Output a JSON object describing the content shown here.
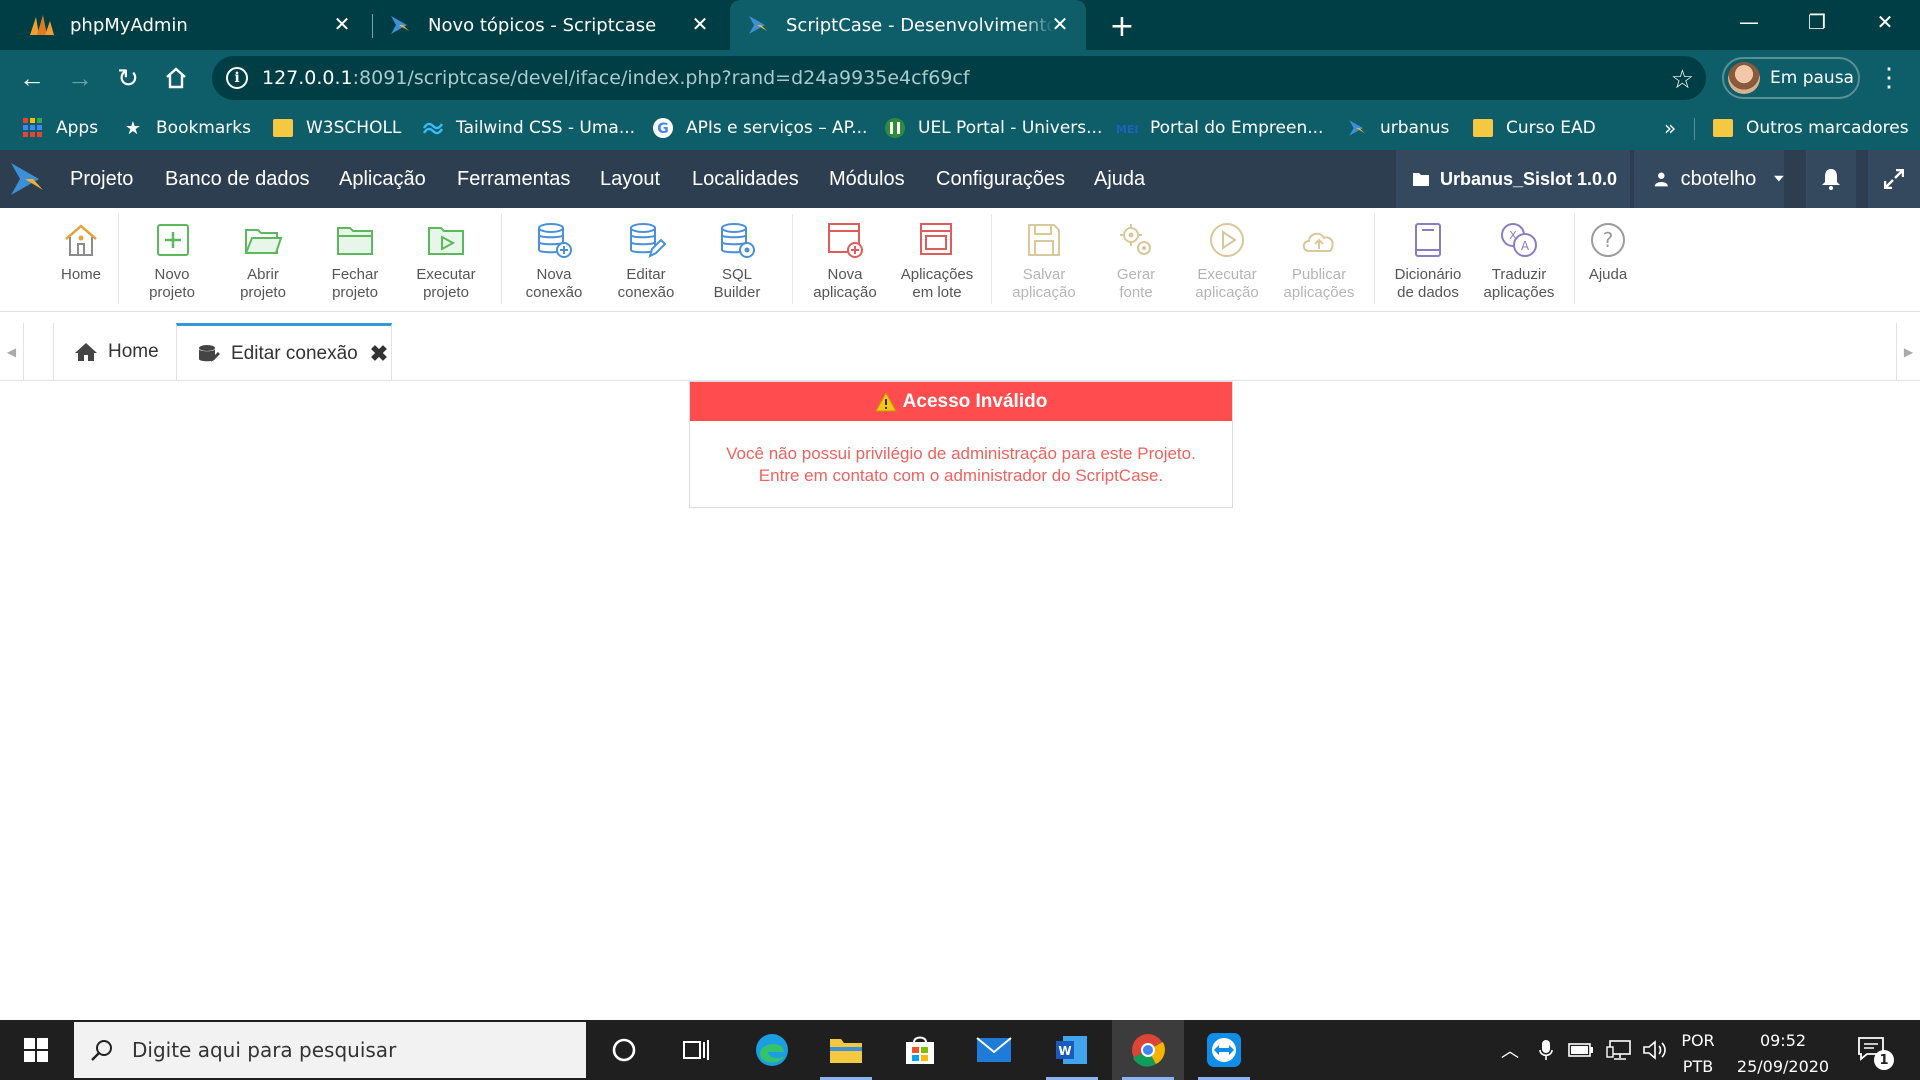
{
  "browser": {
    "tabs": [
      {
        "title": "phpMyAdmin",
        "icon": "phpmyadmin-icon"
      },
      {
        "title": "Novo tópicos - Scriptcase",
        "icon": "scriptcase-icon"
      },
      {
        "title": "ScriptCase - Desenvolvimento - c",
        "icon": "scriptcase-icon",
        "active": true
      }
    ],
    "address": {
      "host": "127.0.0.1",
      "rest": ":8091/scriptcase/devel/iface/index.php?rand=d24a9935e4cf69cf"
    },
    "profile_label": "Em pausa",
    "bookmarks": [
      {
        "label": "Apps"
      },
      {
        "label": "Bookmarks"
      },
      {
        "label": "W3SCHOLL"
      },
      {
        "label": "Tailwind CSS - Uma..."
      },
      {
        "label": "APIs e serviços – AP..."
      },
      {
        "label": "UEL Portal - Univers..."
      },
      {
        "label": "Portal do Empreen..."
      },
      {
        "label": "urbanus"
      },
      {
        "label": "Curso EAD"
      },
      {
        "label": "Outros marcadores"
      }
    ],
    "bookmarks_overflow": "»",
    "colors": {
      "tabstrip": "#003e45",
      "toolbar": "#0e5e6a"
    }
  },
  "menu": {
    "items": [
      "Projeto",
      "Banco de dados",
      "Aplicação",
      "Ferramentas",
      "Layout",
      "Localidades",
      "Módulos",
      "Configurações",
      "Ajuda"
    ],
    "project": "Urbanus_Sislot 1.0.0",
    "user": "cbotelho"
  },
  "ribbon": [
    {
      "label1": "Home",
      "label2": "",
      "icon": "home-icon",
      "enabled": true
    },
    {
      "label1": "Novo",
      "label2": "projeto",
      "icon": "new-project-icon",
      "enabled": true
    },
    {
      "label1": "Abrir",
      "label2": "projeto",
      "icon": "open-folder-icon",
      "enabled": true
    },
    {
      "label1": "Fechar",
      "label2": "projeto",
      "icon": "close-folder-icon",
      "enabled": true
    },
    {
      "label1": "Executar",
      "label2": "projeto",
      "icon": "run-project-icon",
      "enabled": true
    },
    {
      "label1": "Nova",
      "label2": "conexão",
      "icon": "new-connection-icon",
      "enabled": true
    },
    {
      "label1": "Editar",
      "label2": "conexão",
      "icon": "edit-connection-icon",
      "enabled": true
    },
    {
      "label1": "SQL",
      "label2": "Builder",
      "icon": "sql-builder-icon",
      "enabled": true
    },
    {
      "label1": "Nova",
      "label2": "aplicação",
      "icon": "new-app-icon",
      "enabled": true
    },
    {
      "label1": "Aplicações",
      "label2": "em lote",
      "icon": "batch-apps-icon",
      "enabled": true
    },
    {
      "label1": "Salvar",
      "label2": "aplicação",
      "icon": "save-icon",
      "enabled": false
    },
    {
      "label1": "Gerar",
      "label2": "fonte",
      "icon": "gears-icon",
      "enabled": false
    },
    {
      "label1": "Executar",
      "label2": "aplicação",
      "icon": "play-icon",
      "enabled": false
    },
    {
      "label1": "Publicar",
      "label2": "aplicações",
      "icon": "cloud-upload-icon",
      "enabled": false
    },
    {
      "label1": "Dicionário",
      "label2": "de dados",
      "icon": "dictionary-icon",
      "enabled": true
    },
    {
      "label1": "Traduzir",
      "label2": "aplicações",
      "icon": "translate-icon",
      "enabled": true
    },
    {
      "label1": "Ajuda",
      "label2": "",
      "icon": "help-icon",
      "enabled": true
    }
  ],
  "inner_tabs": [
    {
      "label": "Home",
      "icon": "home-icon"
    },
    {
      "label": "Editar conexão",
      "icon": "database-icon",
      "active": true
    }
  ],
  "alert": {
    "title": "Acesso Inválido",
    "line1": "Você não possui privilégio de administração para este Projeto.",
    "line2": "Entre em contato com o administrador do ScriptCase.",
    "color": "#ff4d4f"
  },
  "taskbar": {
    "search_placeholder": "Digite aqui para pesquisar",
    "language_top": "POR",
    "language_bottom": "PTB",
    "time": "09:52",
    "date": "25/09/2020",
    "notification_count": "1"
  }
}
